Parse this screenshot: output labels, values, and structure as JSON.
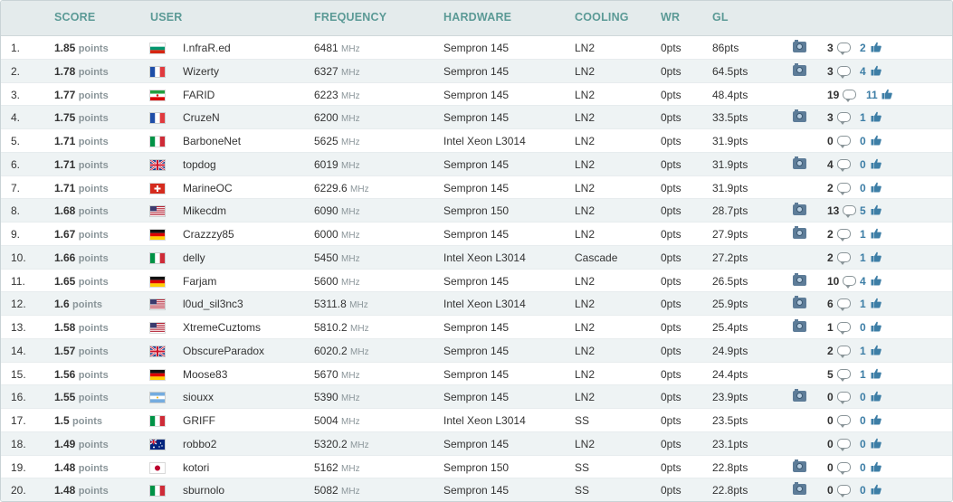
{
  "headers": {
    "score": "SCORE",
    "user": "USER",
    "frequency": "FREQUENCY",
    "hardware": "HARDWARE",
    "cooling": "COOLING",
    "wr": "WR",
    "gl": "GL"
  },
  "units": {
    "points": "points",
    "mhz": "MHz"
  },
  "colors": {
    "header_text": "#5b9a96",
    "header_bg": "#e4ebec",
    "row_alt_bg": "#eef3f4",
    "like_blue": "#3d7ea6"
  },
  "rows": [
    {
      "rank": "1.",
      "score": "1.85",
      "flag": "bulgaria",
      "user": "I.nfraR.ed",
      "freq": "6481",
      "hardware": "Sempron 145",
      "cooling": "LN2",
      "wr": "0pts",
      "gl": "86pts",
      "photo": true,
      "comments": "3",
      "likes": "2"
    },
    {
      "rank": "2.",
      "score": "1.78",
      "flag": "france",
      "user": "Wizerty",
      "freq": "6327",
      "hardware": "Sempron 145",
      "cooling": "LN2",
      "wr": "0pts",
      "gl": "64.5pts",
      "photo": true,
      "comments": "3",
      "likes": "4"
    },
    {
      "rank": "3.",
      "score": "1.77",
      "flag": "iran",
      "user": "FARID",
      "freq": "6223",
      "hardware": "Sempron 145",
      "cooling": "LN2",
      "wr": "0pts",
      "gl": "48.4pts",
      "photo": false,
      "comments": "19",
      "likes": "11"
    },
    {
      "rank": "4.",
      "score": "1.75",
      "flag": "france",
      "user": "CruzeN",
      "freq": "6200",
      "hardware": "Sempron 145",
      "cooling": "LN2",
      "wr": "0pts",
      "gl": "33.5pts",
      "photo": true,
      "comments": "3",
      "likes": "1"
    },
    {
      "rank": "5.",
      "score": "1.71",
      "flag": "italy",
      "user": "BarboneNet",
      "freq": "5625",
      "hardware": "Intel Xeon L3014",
      "cooling": "LN2",
      "wr": "0pts",
      "gl": "31.9pts",
      "photo": false,
      "comments": "0",
      "likes": "0"
    },
    {
      "rank": "6.",
      "score": "1.71",
      "flag": "uk",
      "user": "topdog",
      "freq": "6019",
      "hardware": "Sempron 145",
      "cooling": "LN2",
      "wr": "0pts",
      "gl": "31.9pts",
      "photo": true,
      "comments": "4",
      "likes": "0"
    },
    {
      "rank": "7.",
      "score": "1.71",
      "flag": "switzerland",
      "user": "MarineOC",
      "freq": "6229.6",
      "hardware": "Sempron 145",
      "cooling": "LN2",
      "wr": "0pts",
      "gl": "31.9pts",
      "photo": false,
      "comments": "2",
      "likes": "0"
    },
    {
      "rank": "8.",
      "score": "1.68",
      "flag": "usa",
      "user": "Mikecdm",
      "freq": "6090",
      "hardware": "Sempron 150",
      "cooling": "LN2",
      "wr": "0pts",
      "gl": "28.7pts",
      "photo": true,
      "comments": "13",
      "likes": "5"
    },
    {
      "rank": "9.",
      "score": "1.67",
      "flag": "germany",
      "user": "Crazzzy85",
      "freq": "6000",
      "hardware": "Sempron 145",
      "cooling": "LN2",
      "wr": "0pts",
      "gl": "27.9pts",
      "photo": true,
      "comments": "2",
      "likes": "1"
    },
    {
      "rank": "10.",
      "score": "1.66",
      "flag": "italy",
      "user": "delly",
      "freq": "5450",
      "hardware": "Intel Xeon L3014",
      "cooling": "Cascade",
      "wr": "0pts",
      "gl": "27.2pts",
      "photo": false,
      "comments": "2",
      "likes": "1"
    },
    {
      "rank": "11.",
      "score": "1.65",
      "flag": "germany",
      "user": "Farjam",
      "freq": "5600",
      "hardware": "Sempron 145",
      "cooling": "LN2",
      "wr": "0pts",
      "gl": "26.5pts",
      "photo": true,
      "comments": "10",
      "likes": "4"
    },
    {
      "rank": "12.",
      "score": "1.6",
      "flag": "usa",
      "user": "l0ud_sil3nc3",
      "freq": "5311.8",
      "hardware": "Intel Xeon L3014",
      "cooling": "LN2",
      "wr": "0pts",
      "gl": "25.9pts",
      "photo": true,
      "comments": "6",
      "likes": "1"
    },
    {
      "rank": "13.",
      "score": "1.58",
      "flag": "usa",
      "user": "XtremeCuztoms",
      "freq": "5810.2",
      "hardware": "Sempron 145",
      "cooling": "LN2",
      "wr": "0pts",
      "gl": "25.4pts",
      "photo": true,
      "comments": "1",
      "likes": "0"
    },
    {
      "rank": "14.",
      "score": "1.57",
      "flag": "uk",
      "user": "ObscureParadox",
      "freq": "6020.2",
      "hardware": "Sempron 145",
      "cooling": "LN2",
      "wr": "0pts",
      "gl": "24.9pts",
      "photo": false,
      "comments": "2",
      "likes": "1"
    },
    {
      "rank": "15.",
      "score": "1.56",
      "flag": "germany",
      "user": "Moose83",
      "freq": "5670",
      "hardware": "Sempron 145",
      "cooling": "LN2",
      "wr": "0pts",
      "gl": "24.4pts",
      "photo": false,
      "comments": "5",
      "likes": "1"
    },
    {
      "rank": "16.",
      "score": "1.55",
      "flag": "argentina",
      "user": "siouxx",
      "freq": "5390",
      "hardware": "Sempron 145",
      "cooling": "LN2",
      "wr": "0pts",
      "gl": "23.9pts",
      "photo": true,
      "comments": "0",
      "likes": "0"
    },
    {
      "rank": "17.",
      "score": "1.5",
      "flag": "italy",
      "user": "GRIFF",
      "freq": "5004",
      "hardware": "Intel Xeon L3014",
      "cooling": "SS",
      "wr": "0pts",
      "gl": "23.5pts",
      "photo": false,
      "comments": "0",
      "likes": "0"
    },
    {
      "rank": "18.",
      "score": "1.49",
      "flag": "australia",
      "user": "robbo2",
      "freq": "5320.2",
      "hardware": "Sempron 145",
      "cooling": "LN2",
      "wr": "0pts",
      "gl": "23.1pts",
      "photo": false,
      "comments": "0",
      "likes": "0"
    },
    {
      "rank": "19.",
      "score": "1.48",
      "flag": "japan",
      "user": "kotori",
      "freq": "5162",
      "hardware": "Sempron 150",
      "cooling": "SS",
      "wr": "0pts",
      "gl": "22.8pts",
      "photo": true,
      "comments": "0",
      "likes": "0"
    },
    {
      "rank": "20.",
      "score": "1.48",
      "flag": "italy",
      "user": "sburnolo",
      "freq": "5082",
      "hardware": "Sempron 145",
      "cooling": "SS",
      "wr": "0pts",
      "gl": "22.8pts",
      "photo": true,
      "comments": "0",
      "likes": "0"
    }
  ]
}
